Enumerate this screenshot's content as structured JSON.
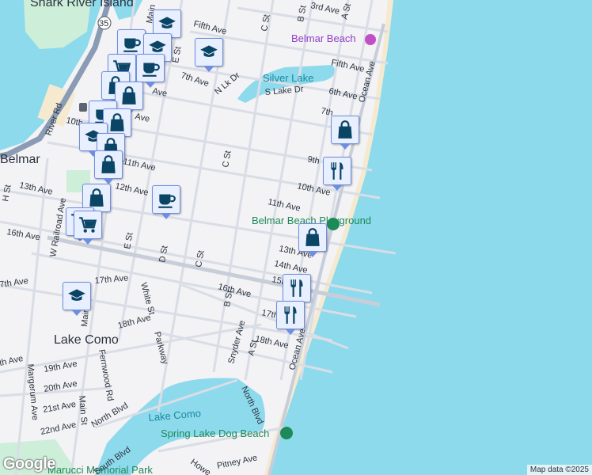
{
  "map": {
    "labels": {
      "shark_river_island": "Shark River Island",
      "route_35": "35",
      "belmar": "Belmar",
      "lake_como_town": "Lake Como",
      "belmar_beach": "Belmar Beach",
      "silver_lake": "Silver Lake",
      "lake_como": "Lake Como",
      "belmar_beach_playground": "Belmar Beach Playground",
      "spring_lake_dog_beach": "Spring Lake Dog Beach",
      "marucci_park": "Marucci Memorial Park"
    },
    "streets": {
      "third_ave": "3rd Ave",
      "fifth_ave_1": "Fifth Ave",
      "fifth_ave_2": "Fifth Ave",
      "seventh_ave": "7th Ave",
      "sixth_ave": "6th Ave",
      "n_lk_dr": "N Lk Dr",
      "s_lake_dr": "S Lake Dr",
      "seventh_ave_2": "7th",
      "ninth_ave_w": "Ave",
      "tenth_ave_w": "10th",
      "tenth_ave_w2": "Ave",
      "eleventh_w": "11th Ave",
      "twelfth_ave": "12th Ave",
      "thirteenth_w": "13th Ave",
      "sixteenth_w": "16th Ave",
      "eleventh_e": "11th Ave",
      "tenth_e": "10th Ave",
      "ninth_e": "9th",
      "thirteenth_e": "13th Ave",
      "fourteenth": "14th Ave",
      "fifteenth": "15th",
      "sixteenth": "16th Ave",
      "seventeenth_e": "17th Ave",
      "eighteenth_e": "18th Ave",
      "seventeenth_w": "17th Ave",
      "seventeenth_far": "7th Ave",
      "eighteenth_w": "18th Ave",
      "eighteenth_far": "th Ave",
      "nineteenth": "19th Ave",
      "twentieth": "20th Ave",
      "twentyfirst": "21st Ave",
      "twentysecond": "22nd Ave",
      "b_st_n": "B St",
      "a_st_n": "A St",
      "c_st_n": "C St",
      "c_st_m": "C St",
      "e_st_n": "E St",
      "main_n": "Main",
      "river_rd": "River Rd",
      "w_railroad": "W Railroad Ave",
      "h_st": "H St",
      "e_st_s": "E St",
      "d_st": "D St",
      "c_st_s": "C St",
      "b_st_s": "B St",
      "white_st": "White St",
      "parkway": "Parkway",
      "main_st": "Main St",
      "main_st2": "Main",
      "fernwood": "Fernwood Rd",
      "margerum": "Margerum Ave",
      "snyder": "Snyder Ave",
      "a_st_s": "A St",
      "ocean_ave": "Ocean Ave",
      "ocean_ave_n": "Ocean Ave",
      "north_blvd_w": "North Blvd",
      "north_blvd_e": "North Blvd",
      "south_blvd": "South Blvd",
      "pitney": "Pitney Ave",
      "howe": "Howe"
    },
    "markers": [
      {
        "type": "school-icon"
      },
      {
        "type": "coffee-icon"
      },
      {
        "type": "school-icon"
      },
      {
        "type": "school-icon"
      },
      {
        "type": "cart-icon"
      },
      {
        "type": "coffee-icon"
      },
      {
        "type": "shopping-bag-icon"
      },
      {
        "type": "shopping-bag-icon"
      },
      {
        "type": "coffee-icon"
      },
      {
        "type": "shopping-bag-icon"
      },
      {
        "type": "school-icon"
      },
      {
        "type": "shopping-bag-icon"
      },
      {
        "type": "shopping-bag-icon"
      },
      {
        "type": "shopping-bag-icon"
      },
      {
        "type": "cart-icon"
      },
      {
        "type": "cart-icon"
      },
      {
        "type": "coffee-icon"
      },
      {
        "type": "shopping-bag-icon"
      },
      {
        "type": "restaurant-icon"
      },
      {
        "type": "shopping-bag-icon"
      },
      {
        "type": "restaurant-icon"
      },
      {
        "type": "restaurant-icon"
      },
      {
        "type": "school-icon"
      }
    ],
    "colors": {
      "water": "#8ddaec",
      "land": "#f3f2f4",
      "park": "#cdeed8",
      "marker_icon": "#0b4566",
      "sand": "#f5ead0"
    }
  },
  "attribution": {
    "logo": "Google",
    "map_data": "Map data ©2025"
  }
}
